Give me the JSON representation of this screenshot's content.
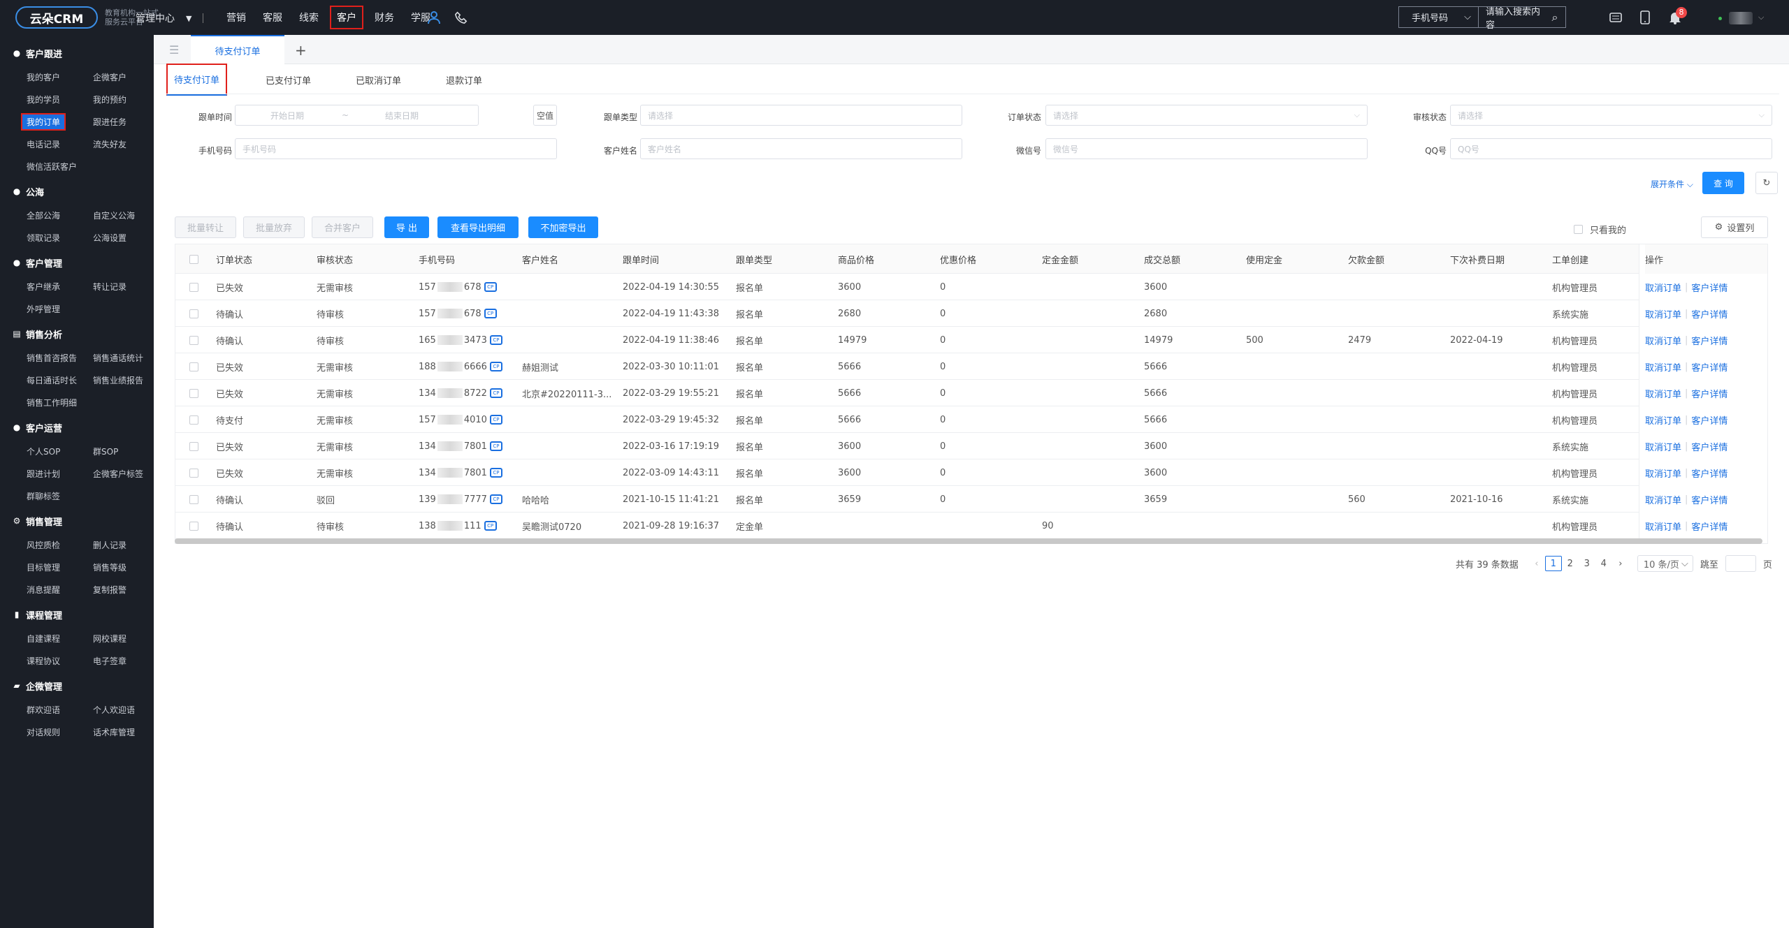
{
  "topbar": {
    "logo_text": "云朵CRM",
    "logo_sub": "教育机构一站式服务云平台",
    "mgr_center": "管理中心",
    "nav": [
      "营销",
      "客服",
      "线索",
      "客户",
      "财务",
      "学服"
    ],
    "search_type": "手机号码",
    "search_placeholder": "请输入搜索内容",
    "notify_count": "8"
  },
  "sidebar": [
    {
      "title": "客户跟进",
      "icon": "person-icon",
      "items": [
        "我的客户",
        "企微客户",
        "我的学员",
        "我的预约",
        "我的订单",
        "跟进任务",
        "电话记录",
        "流失好友",
        "微信活跃客户"
      ]
    },
    {
      "title": "公海",
      "icon": "person-icon",
      "items": [
        "全部公海",
        "自定义公海",
        "领取记录",
        "公海设置"
      ]
    },
    {
      "title": "客户管理",
      "icon": "person-icon",
      "items": [
        "客户继承",
        "转让记录",
        "外呼管理"
      ]
    },
    {
      "title": "销售分析",
      "icon": "chart-icon",
      "items": [
        "销售首咨报告",
        "销售通话统计",
        "每日通话时长",
        "销售业绩报告",
        "销售工作明细"
      ]
    },
    {
      "title": "客户运营",
      "icon": "person-icon",
      "items": [
        "个人SOP",
        "群SOP",
        "跟进计划",
        "企微客户标签",
        "群聊标签"
      ]
    },
    {
      "title": "销售管理",
      "icon": "gear-icon",
      "items": [
        "风控质检",
        "删人记录",
        "目标管理",
        "销售等级",
        "消息提醒",
        "复制报警"
      ]
    },
    {
      "title": "课程管理",
      "icon": "book-icon",
      "items": [
        "自建课程",
        "网校课程",
        "课程协议",
        "电子签章"
      ]
    },
    {
      "title": "企微管理",
      "icon": "folder-icon",
      "items": [
        "群欢迎语",
        "个人欢迎语",
        "对话规则",
        "话术库管理"
      ]
    }
  ],
  "page_tab": "待支付订单",
  "sub_tabs": [
    "待支付订单",
    "已支付订单",
    "已取消订单",
    "退款订单"
  ],
  "filters": {
    "follow_time": "跟单时间",
    "start_date": "开始日期",
    "range_sep": "~",
    "end_date": "结束日期",
    "empty_btn": "空值",
    "follow_type": "跟单类型",
    "order_status": "订单状态",
    "audit_status": "审核状态",
    "select_ph": "请选择",
    "phone": "手机号码",
    "phone_ph": "手机号码",
    "cust_name": "客户姓名",
    "cust_name_ph": "客户姓名",
    "wechat": "微信号",
    "wechat_ph": "微信号",
    "qq": "QQ号",
    "qq_ph": "QQ号",
    "expand": "展开条件",
    "query": "查 询"
  },
  "toolbar": {
    "batch_transfer": "批量转让",
    "batch_release": "批量放弃",
    "merge": "合并客户",
    "export": "导 出",
    "view_export": "查看导出明细",
    "plain_export": "不加密导出",
    "only_mine": "只看我的",
    "col_settings": "设置列"
  },
  "table": {
    "columns": [
      "订单状态",
      "审核状态",
      "手机号码",
      "客户姓名",
      "跟单时间",
      "跟单类型",
      "商品价格",
      "优惠价格",
      "定金金额",
      "成交总额",
      "使用定金",
      "欠款金额",
      "下次补费日期",
      "工单创建",
      "操作"
    ],
    "op_cancel": "取消订单",
    "op_detail": "客户详情",
    "rows": [
      {
        "status": "已失效",
        "audit": "无需审核",
        "p1": "157",
        "p2": "678",
        "name": "",
        "time": "2022-04-19 14:30:55",
        "type": "报名单",
        "price": "3600",
        "discount": "0",
        "deposit": "",
        "total": "3600",
        "used": "",
        "owe": "",
        "next": "",
        "creator": "机构管理员"
      },
      {
        "status": "待确认",
        "audit": "待审核",
        "p1": "157",
        "p2": "678",
        "name": "",
        "time": "2022-04-19 11:43:38",
        "type": "报名单",
        "price": "2680",
        "discount": "0",
        "deposit": "",
        "total": "2680",
        "used": "",
        "owe": "",
        "next": "",
        "creator": "系统实施"
      },
      {
        "status": "待确认",
        "audit": "待审核",
        "p1": "165",
        "p2": "3473",
        "name": "",
        "time": "2022-04-19 11:38:46",
        "type": "报名单",
        "price": "14979",
        "discount": "0",
        "deposit": "",
        "total": "14979",
        "used": "500",
        "owe": "2479",
        "next": "2022-04-19",
        "creator": "机构管理员"
      },
      {
        "status": "已失效",
        "audit": "无需审核",
        "p1": "188",
        "p2": "6666",
        "name": "赫姐测试",
        "time": "2022-03-30 10:11:01",
        "type": "报名单",
        "price": "5666",
        "discount": "0",
        "deposit": "",
        "total": "5666",
        "used": "",
        "owe": "",
        "next": "",
        "creator": "机构管理员"
      },
      {
        "status": "已失效",
        "audit": "无需审核",
        "p1": "134",
        "p2": "8722",
        "name": "北京#20220111-3...",
        "time": "2022-03-29 19:55:21",
        "type": "报名单",
        "price": "5666",
        "discount": "0",
        "deposit": "",
        "total": "5666",
        "used": "",
        "owe": "",
        "next": "",
        "creator": "机构管理员"
      },
      {
        "status": "待支付",
        "audit": "无需审核",
        "p1": "157",
        "p2": "4010",
        "name": "",
        "time": "2022-03-29 19:45:32",
        "type": "报名单",
        "price": "5666",
        "discount": "0",
        "deposit": "",
        "total": "5666",
        "used": "",
        "owe": "",
        "next": "",
        "creator": "机构管理员"
      },
      {
        "status": "已失效",
        "audit": "无需审核",
        "p1": "134",
        "p2": "7801",
        "name": "",
        "time": "2022-03-16 17:19:19",
        "type": "报名单",
        "price": "3600",
        "discount": "0",
        "deposit": "",
        "total": "3600",
        "used": "",
        "owe": "",
        "next": "",
        "creator": "系统实施"
      },
      {
        "status": "已失效",
        "audit": "无需审核",
        "p1": "134",
        "p2": "7801",
        "name": "",
        "time": "2022-03-09 14:43:11",
        "type": "报名单",
        "price": "3600",
        "discount": "0",
        "deposit": "",
        "total": "3600",
        "used": "",
        "owe": "",
        "next": "",
        "creator": "机构管理员"
      },
      {
        "status": "待确认",
        "audit": "驳回",
        "p1": "139",
        "p2": "7777",
        "name": "哈哈哈",
        "time": "2021-10-15 11:41:21",
        "type": "报名单",
        "price": "3659",
        "discount": "0",
        "deposit": "",
        "total": "3659",
        "used": "",
        "owe": "560",
        "next": "2021-10-16",
        "creator": "系统实施"
      },
      {
        "status": "待确认",
        "audit": "待审核",
        "p1": "138",
        "p2": "111",
        "name": "吴瞻测试0720",
        "time": "2021-09-28 19:16:37",
        "type": "定金单",
        "price": "",
        "discount": "",
        "deposit": "90",
        "total": "",
        "used": "",
        "owe": "",
        "next": "",
        "creator": "机构管理员"
      }
    ]
  },
  "pager": {
    "total_text": "共有 39 条数据",
    "pages": [
      "1",
      "2",
      "3",
      "4"
    ],
    "current": "1",
    "size": "10 条/页",
    "goto": "跳至",
    "page_unit": "页"
  }
}
